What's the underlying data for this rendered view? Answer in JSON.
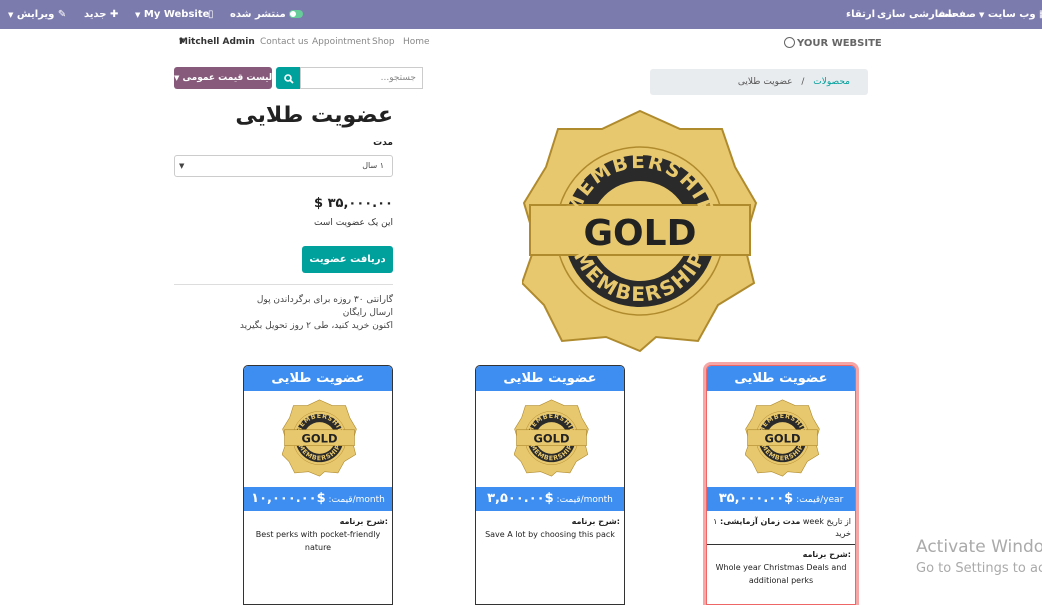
{
  "topbar": {
    "website_menu": "وب سایت",
    "pages": "صفحات",
    "customize": "سفارشی سازی",
    "promote": "ارتقاء",
    "published": "منتشر شده",
    "my_website": "My Website",
    "new": "جدید",
    "edit": "ویرایش"
  },
  "nav": {
    "admin": "Mitchell Admin",
    "contact": "Contact us",
    "appointment": "Appointment",
    "shop": "Shop",
    "home": "Home"
  },
  "logo_text": "YOUR WEBSITE",
  "pricelist_label": "لیست قیمت عمومی",
  "search_placeholder": "جستجو...",
  "breadcrumb": {
    "products": "محصولات",
    "separator": "/",
    "current": "عضویت طلایی"
  },
  "product": {
    "title": "عضویت طلایی",
    "duration_label": "مدت",
    "duration_value": "۱ سال",
    "price": "$ ۳۵,۰۰۰.۰۰",
    "price_note": "این یک عضویت است",
    "buy_button": "دریافت عضویت",
    "notes": [
      "گارانتی ۳۰ روزه برای برگرداندن پول",
      "ارسال رایگان",
      "اکنون خرید کنید، طی ۲ روز تحویل بگیرید"
    ]
  },
  "badge": {
    "ring_text": "MEMBERSHIP",
    "center_text": "GOLD"
  },
  "cards": [
    {
      "title": "عضویت طلایی",
      "price_label": "قیمت:",
      "price": "$۳۵,۰۰۰.۰۰",
      "period": "/year",
      "trial_prefix": "از تاریخ week",
      "trial_label": "مدت زمان آزمایشی:",
      "trial_suffix": "۱ خرید",
      "desc_label": "شرح برنامه:",
      "desc": "Whole year Christmas Deals and additional perks"
    },
    {
      "title": "عضویت طلایی",
      "price_label": "قیمت:",
      "price": "$۳,۵۰۰.۰۰",
      "period": "/month",
      "desc_label": "شرح برنامه:",
      "desc": "Save A lot by choosing this pack"
    },
    {
      "title": "عضویت طلایی",
      "price_label": "قیمت:",
      "price": "$۱۰,۰۰۰.۰۰",
      "period": "/month",
      "desc_label": "شرح برنامه:",
      "desc": "Best perks with pocket-friendly nature"
    }
  ],
  "watermark": {
    "line1": "Activate Windo",
    "line2": "Go to Settings to ac"
  },
  "colors": {
    "topbar": "#7c7bad",
    "accent": "#00a09d",
    "card_blue": "#3d8ef0",
    "gold": "#e8c86e"
  }
}
